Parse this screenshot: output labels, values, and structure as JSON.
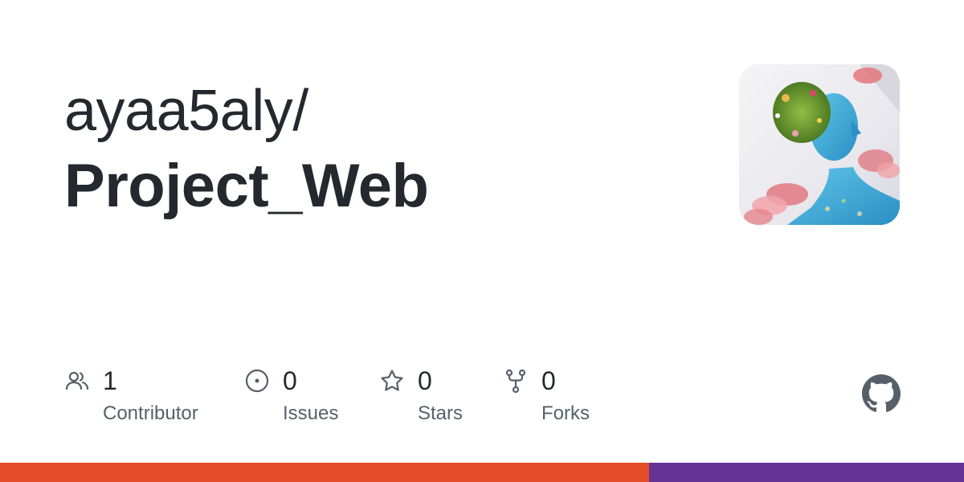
{
  "repo": {
    "owner": "ayaa5aly/",
    "name": "Project_Web"
  },
  "avatar": {
    "alt": "avatar"
  },
  "stats": [
    {
      "icon": "people-icon",
      "value": "1",
      "label": "Contributor"
    },
    {
      "icon": "issue-opened-icon",
      "value": "0",
      "label": "Issues"
    },
    {
      "icon": "star-icon",
      "value": "0",
      "label": "Stars"
    },
    {
      "icon": "repo-forked-icon",
      "value": "0",
      "label": "Forks"
    }
  ],
  "brand_icon": "github-mark-icon",
  "language_bar": [
    {
      "color": "#e34c26",
      "fraction": 0.673
    },
    {
      "color": "#663399",
      "fraction": 0.327
    }
  ],
  "colors": {
    "text": "#24292f",
    "muted": "#57606a",
    "icon": "#57606a"
  }
}
